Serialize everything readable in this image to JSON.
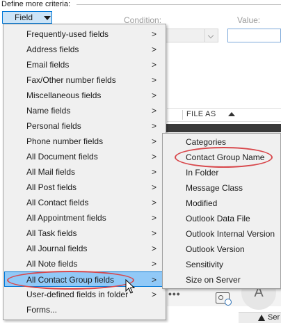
{
  "dialog": {
    "criteria_title": "Define more criteria:",
    "field_button": "Field",
    "condition_label": "Condition:",
    "value_label": "Value:",
    "column_header": "FILE AS",
    "ellipsis": "•••",
    "avatar_initial": "A",
    "status_text": "Ser"
  },
  "field_menu": {
    "items": [
      {
        "label": "Frequently-used fields",
        "submenu": true
      },
      {
        "label": "Address fields",
        "submenu": true
      },
      {
        "label": "Email fields",
        "submenu": true
      },
      {
        "label": "Fax/Other number fields",
        "submenu": true
      },
      {
        "label": "Miscellaneous fields",
        "submenu": true
      },
      {
        "label": "Name fields",
        "submenu": true
      },
      {
        "label": "Personal fields",
        "submenu": true
      },
      {
        "label": "Phone number fields",
        "submenu": true
      },
      {
        "label": "All Document fields",
        "submenu": true
      },
      {
        "label": "All Mail fields",
        "submenu": true
      },
      {
        "label": "All Post fields",
        "submenu": true
      },
      {
        "label": "All Contact fields",
        "submenu": true
      },
      {
        "label": "All Appointment fields",
        "submenu": true
      },
      {
        "label": "All Task fields",
        "submenu": true
      },
      {
        "label": "All Journal fields",
        "submenu": true
      },
      {
        "label": "All Note fields",
        "submenu": true
      },
      {
        "label": "All Contact Group fields",
        "submenu": true,
        "highlighted": true
      },
      {
        "label": "User-defined fields in folder",
        "submenu": true
      },
      {
        "label": "Forms...",
        "submenu": false
      }
    ],
    "chevron": ">"
  },
  "contact_group_submenu": {
    "items": [
      {
        "label": "Categories"
      },
      {
        "label": "Contact Group Name",
        "circled": true
      },
      {
        "label": "In Folder"
      },
      {
        "label": "Message Class"
      },
      {
        "label": "Modified"
      },
      {
        "label": "Outlook Data File"
      },
      {
        "label": "Outlook Internal Version"
      },
      {
        "label": "Outlook Version"
      },
      {
        "label": "Sensitivity"
      },
      {
        "label": "Size on Server"
      }
    ]
  },
  "colors": {
    "highlight": "#91c9f7",
    "annotation": "#d8474b",
    "menu_bg": "#f0f0f0"
  }
}
